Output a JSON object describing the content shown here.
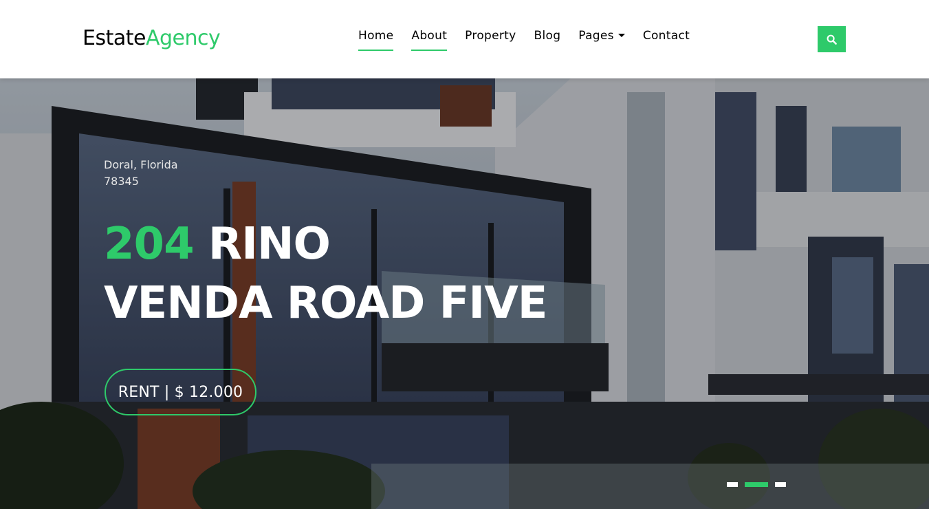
{
  "brand": {
    "name": "Estate",
    "accent": "Agency"
  },
  "nav": {
    "items": [
      {
        "label": "Home",
        "underlined": true
      },
      {
        "label": "About",
        "underlined": true
      },
      {
        "label": "Property",
        "underlined": false
      },
      {
        "label": "Blog",
        "underlined": false
      },
      {
        "label": "Pages",
        "underlined": false,
        "dropdown": true
      },
      {
        "label": "Contact",
        "underlined": false
      }
    ]
  },
  "search": {
    "icon": "search-icon"
  },
  "hero": {
    "location_line1": "Doral, Florida",
    "location_line2": "78345",
    "title_number": "204",
    "title_rest_line1": " RINO",
    "title_line2": "VENDA ROAD FIVE",
    "price_label": "RENT | $ 12.000"
  },
  "carousel": {
    "slides": 3,
    "active_index": 1
  },
  "colors": {
    "accent": "#2eca6a",
    "header_bg": "#ffffff",
    "text_dark": "#000000"
  }
}
